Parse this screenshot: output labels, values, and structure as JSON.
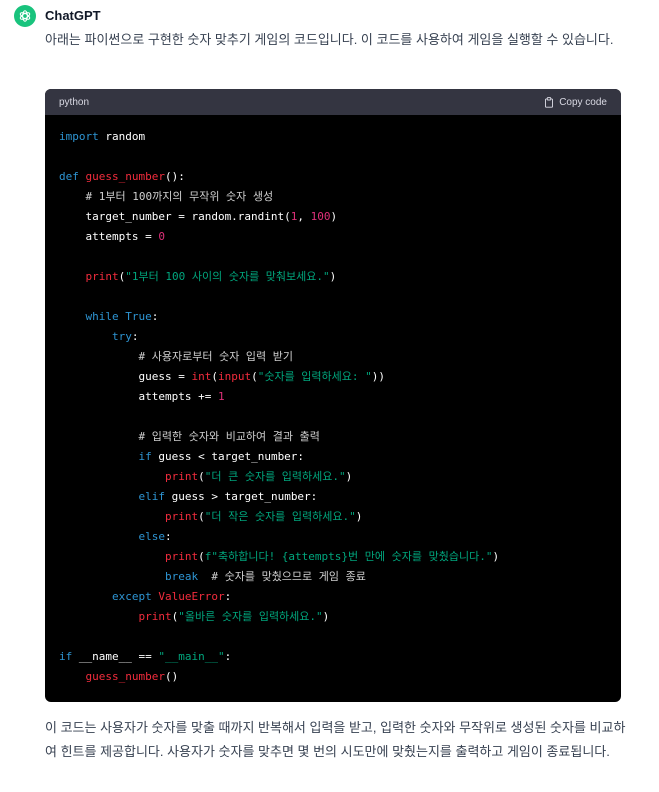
{
  "author": {
    "name": "ChatGPT"
  },
  "intro_text": "아래는 파이썬으로 구현한 숫자 맞추기 게임의 코드입니다. 이 코드를 사용하여 게임을 실행할 수 있습니다.",
  "code": {
    "language": "python",
    "copy_label": "Copy code",
    "lines": [
      "import random",
      "",
      "def guess_number():",
      "    # 1부터 100까지의 무작위 숫자 생성",
      "    target_number = random.randint(1, 100)",
      "    attempts = 0",
      "",
      "    print(\"1부터 100 사이의 숫자를 맞춰보세요.\")",
      "",
      "    while True:",
      "        try:",
      "            # 사용자로부터 숫자 입력 받기",
      "            guess = int(input(\"숫자를 입력하세요: \"))",
      "            attempts += 1",
      "",
      "            # 입력한 숫자와 비교하여 결과 출력",
      "            if guess < target_number:",
      "                print(\"더 큰 숫자를 입력하세요.\")",
      "            elif guess > target_number:",
      "                print(\"더 작은 숫자를 입력하세요.\")",
      "            else:",
      "                print(f\"축하합니다! {attempts}번 만에 숫자를 맞췄습니다.\")",
      "                break  # 숫자를 맞췄으므로 게임 종료",
      "        except ValueError:",
      "            print(\"올바른 숫자를 입력하세요.\")",
      "",
      "if __name__ == \"__main__\":",
      "    guess_number()"
    ]
  },
  "outro_text": "이 코드는 사용자가 숫자를 맞출 때까지 반복해서 입력을 받고, 입력한 숫자와 무작위로 생성된 숫자를 비교하여 힌트를 제공합니다. 사용자가 숫자를 맞추면 몇 번의 시도만에 맞췄는지를 출력하고 게임이 종료됩니다.",
  "colors": {
    "avatar_bg": "#19c37d",
    "code_bg": "#000000",
    "code_header_bg": "#343541",
    "keyword": "#2e95d3",
    "function": "#f22c3d",
    "number": "#df3079",
    "string": "#00a67d"
  },
  "icons": {
    "avatar": "openai-logo-icon",
    "copy": "clipboard-icon"
  }
}
